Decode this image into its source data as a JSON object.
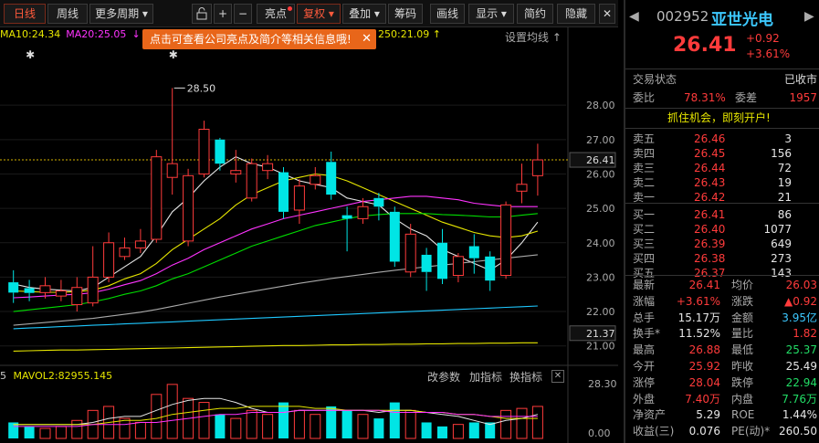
{
  "toolbar": {
    "items": [
      {
        "label": "日线",
        "active": true
      },
      {
        "label": "周线"
      },
      {
        "label": "更多周期",
        "dropdown": true
      },
      {
        "label": "亮点",
        "dot": true
      },
      {
        "label": "复权",
        "dropdown": true,
        "active": true
      },
      {
        "label": "叠加",
        "dropdown": true
      },
      {
        "label": "筹码"
      },
      {
        "label": "画线"
      },
      {
        "label": "显示",
        "dropdown": true
      },
      {
        "label": "简约"
      },
      {
        "label": "隐藏"
      }
    ]
  },
  "legend": {
    "ma10": "MA10:24.34",
    "ma20": "MA20:25.05",
    "ma250": "250:21.09",
    "setting": "设置均线",
    "tooltip": "点击可查看公司亮点及简介等相关信息哦!",
    "tooltip_close": "✕"
  },
  "volume_legend": {
    "mavol2": "MAVOL2:82955.145",
    "tools": [
      "改参数",
      "加指标",
      "换指标"
    ],
    "close": "✕",
    "left_digit": "5"
  },
  "chart_data": {
    "type": "candlestick",
    "price_axis": {
      "ticks": [
        28.0,
        27.0,
        26.0,
        25.0,
        24.0,
        23.0,
        22.0,
        21.0
      ],
      "ylim": [
        20.7,
        29.2
      ]
    },
    "current_price_label": "26.41",
    "cursor_price_label": "21.37",
    "high_annotation": "28.50",
    "volume_axis": {
      "ticks": [
        "28.30",
        "0.00"
      ],
      "ylim": [
        0,
        28.3
      ]
    },
    "candles": [
      {
        "o": 22.85,
        "c": 22.55,
        "h": 23.2,
        "l": 22.25
      },
      {
        "o": 22.68,
        "c": 22.54,
        "h": 22.92,
        "l": 22.3
      },
      {
        "o": 22.55,
        "c": 22.75,
        "h": 23.0,
        "l": 22.38
      },
      {
        "o": 22.45,
        "c": 22.6,
        "h": 22.92,
        "l": 22.3
      },
      {
        "o": 22.2,
        "c": 22.7,
        "h": 23.0,
        "l": 22.0
      },
      {
        "o": 22.25,
        "c": 23.0,
        "h": 23.9,
        "l": 22.15
      },
      {
        "o": 23.0,
        "c": 24.0,
        "h": 24.3,
        "l": 22.85
      },
      {
        "o": 23.6,
        "c": 23.85,
        "h": 24.15,
        "l": 23.5
      },
      {
        "o": 23.85,
        "c": 24.05,
        "h": 24.4,
        "l": 23.7
      },
      {
        "o": 24.1,
        "c": 26.5,
        "h": 26.7,
        "l": 24.0
      },
      {
        "o": 25.9,
        "c": 26.3,
        "h": 28.5,
        "l": 25.4
      },
      {
        "o": 24.05,
        "c": 25.95,
        "h": 26.15,
        "l": 23.9
      },
      {
        "o": 26.0,
        "c": 27.3,
        "h": 27.55,
        "l": 25.9
      },
      {
        "o": 27.0,
        "c": 26.3,
        "h": 27.05,
        "l": 26.1
      },
      {
        "o": 26.0,
        "c": 26.1,
        "h": 26.7,
        "l": 25.75
      },
      {
        "o": 25.3,
        "c": 26.3,
        "h": 26.45,
        "l": 25.2
      },
      {
        "o": 26.1,
        "c": 26.3,
        "h": 26.55,
        "l": 25.85
      },
      {
        "o": 26.05,
        "c": 24.9,
        "h": 26.2,
        "l": 24.7
      },
      {
        "o": 24.95,
        "c": 25.65,
        "h": 25.85,
        "l": 24.55
      },
      {
        "o": 25.7,
        "c": 25.95,
        "h": 26.2,
        "l": 25.55
      },
      {
        "o": 26.35,
        "c": 25.4,
        "h": 26.65,
        "l": 25.25
      },
      {
        "o": 24.8,
        "c": 24.7,
        "h": 25.05,
        "l": 23.75
      },
      {
        "o": 24.7,
        "c": 25.05,
        "h": 25.3,
        "l": 24.55
      },
      {
        "o": 25.3,
        "c": 25.05,
        "h": 25.45,
        "l": 24.65
      },
      {
        "o": 24.9,
        "c": 23.45,
        "h": 25.05,
        "l": 23.3
      },
      {
        "o": 23.15,
        "c": 24.25,
        "h": 24.55,
        "l": 23.0
      },
      {
        "o": 23.65,
        "c": 23.15,
        "h": 23.85,
        "l": 22.6
      },
      {
        "o": 24.0,
        "c": 22.95,
        "h": 24.4,
        "l": 22.8
      },
      {
        "o": 23.05,
        "c": 23.6,
        "h": 23.7,
        "l": 22.85
      },
      {
        "o": 23.9,
        "c": 23.55,
        "h": 24.25,
        "l": 23.1
      },
      {
        "o": 23.6,
        "c": 22.9,
        "h": 23.75,
        "l": 22.6
      },
      {
        "o": 23.05,
        "c": 25.1,
        "h": 25.2,
        "l": 22.95
      },
      {
        "o": 25.5,
        "c": 25.7,
        "h": 26.3,
        "l": 25.15
      },
      {
        "o": 25.95,
        "c": 26.41,
        "h": 26.88,
        "l": 25.37
      }
    ],
    "volumes": [
      8,
      6,
      5,
      6,
      9,
      14,
      16,
      10,
      8,
      22,
      27,
      20,
      18,
      12,
      10,
      14,
      12,
      18,
      14,
      12,
      16,
      14,
      12,
      10,
      18,
      14,
      8,
      6,
      7,
      8,
      8,
      14,
      15,
      16
    ],
    "series": [
      {
        "name": "MA5",
        "color": "#e6e6e6",
        "values": [
          22.8,
          22.7,
          22.65,
          22.62,
          22.6,
          22.7,
          23.0,
          23.3,
          23.6,
          24.2,
          24.9,
          25.3,
          25.8,
          26.2,
          26.5,
          26.3,
          26.2,
          26.0,
          25.8,
          25.7,
          25.6,
          25.3,
          25.2,
          25.1,
          24.7,
          24.4,
          24.2,
          23.8,
          23.6,
          23.4,
          23.2,
          23.5,
          24.0,
          24.6
        ]
      },
      {
        "name": "MA10",
        "color": "#e6e600",
        "values": [
          22.6,
          22.58,
          22.56,
          22.56,
          22.58,
          22.62,
          22.75,
          22.95,
          23.1,
          23.4,
          23.8,
          24.1,
          24.4,
          24.7,
          25.1,
          25.4,
          25.6,
          25.8,
          25.9,
          26.0,
          25.95,
          25.8,
          25.6,
          25.4,
          25.2,
          25.0,
          24.8,
          24.6,
          24.45,
          24.3,
          24.2,
          24.15,
          24.2,
          24.34
        ]
      },
      {
        "name": "MA20",
        "color": "#ff33ff",
        "values": [
          22.4,
          22.42,
          22.45,
          22.48,
          22.5,
          22.55,
          22.65,
          22.78,
          22.9,
          23.1,
          23.35,
          23.55,
          23.8,
          24.0,
          24.2,
          24.4,
          24.55,
          24.7,
          24.8,
          24.9,
          25.0,
          25.1,
          25.2,
          25.25,
          25.3,
          25.35,
          25.35,
          25.3,
          25.25,
          25.15,
          25.1,
          25.05,
          25.05,
          25.05
        ]
      },
      {
        "name": "MA30",
        "color": "#00dd00",
        "values": [
          22.0,
          22.05,
          22.1,
          22.15,
          22.2,
          22.28,
          22.38,
          22.5,
          22.6,
          22.75,
          22.95,
          23.1,
          23.3,
          23.5,
          23.7,
          23.9,
          24.05,
          24.2,
          24.35,
          24.5,
          24.6,
          24.7,
          24.78,
          24.82,
          24.85,
          24.85,
          24.85,
          24.82,
          24.8,
          24.78,
          24.75,
          24.75,
          24.8,
          24.85
        ]
      },
      {
        "name": "MA60",
        "color": "#aaaaaa",
        "values": [
          21.6,
          21.64,
          21.68,
          21.72,
          21.76,
          21.8,
          21.86,
          21.92,
          21.98,
          22.06,
          22.15,
          22.24,
          22.33,
          22.42,
          22.5,
          22.58,
          22.66,
          22.74,
          22.82,
          22.89,
          22.96,
          23.02,
          23.08,
          23.14,
          23.2,
          23.25,
          23.3,
          23.35,
          23.4,
          23.45,
          23.5,
          23.55,
          23.6,
          23.65
        ]
      },
      {
        "name": "MA120",
        "color": "#1ec8ff",
        "values": [
          21.5,
          21.52,
          21.54,
          21.56,
          21.58,
          21.6,
          21.62,
          21.64,
          21.66,
          21.68,
          21.7,
          21.72,
          21.74,
          21.76,
          21.78,
          21.8,
          21.82,
          21.84,
          21.86,
          21.88,
          21.9,
          21.92,
          21.94,
          21.96,
          21.98,
          22.0,
          22.02,
          22.04,
          22.06,
          22.08,
          22.1,
          22.12,
          22.14,
          22.16
        ]
      },
      {
        "name": "MA250",
        "color": "#e6e600",
        "values": [
          20.85,
          20.86,
          20.87,
          20.88,
          20.88,
          20.89,
          20.9,
          20.91,
          20.92,
          20.93,
          20.94,
          20.95,
          20.96,
          20.97,
          20.98,
          20.99,
          21.0,
          21.01,
          21.01,
          21.02,
          21.03,
          21.03,
          21.04,
          21.04,
          21.05,
          21.05,
          21.06,
          21.06,
          21.07,
          21.07,
          21.08,
          21.08,
          21.09,
          21.09
        ]
      }
    ],
    "vol_series": [
      {
        "name": "MAVOL1",
        "color": "#e6e6e6",
        "values": [
          7,
          7,
          7,
          7,
          7,
          8,
          10,
          11,
          11,
          14,
          17,
          19,
          20,
          20,
          18,
          15,
          13,
          13,
          14,
          14,
          14,
          14,
          14,
          13,
          14,
          14,
          13,
          12,
          11,
          9,
          7,
          9,
          10,
          12
        ]
      },
      {
        "name": "MAVOL2",
        "color": "#e6e600",
        "values": [
          7,
          7,
          7,
          7,
          7,
          7,
          8,
          9,
          9,
          10,
          12,
          13,
          14,
          15,
          15,
          16,
          16,
          16,
          16,
          15,
          15,
          14,
          14,
          14,
          14,
          14,
          13,
          13,
          12,
          12,
          11,
          10,
          10,
          10
        ]
      },
      {
        "name": "MAVOL3",
        "color": "#ff33ff",
        "values": [
          6,
          6,
          6,
          6,
          6,
          7,
          7,
          7,
          8,
          8,
          9,
          10,
          11,
          12,
          12,
          13,
          13,
          13,
          14,
          14,
          14,
          14,
          14,
          14,
          13,
          13,
          13,
          13,
          12,
          12,
          11,
          11,
          11,
          11
        ]
      }
    ]
  },
  "quote": {
    "code": "002952",
    "name": "亚世光电",
    "price": "26.41",
    "change": "+0.92",
    "change_pct": "+3.61%",
    "status_label": "交易状态",
    "status_value": "已收市",
    "weibi_label": "委比",
    "weibi_value": "78.31%",
    "weicha_label": "委差",
    "weicha_value": "1957",
    "promo": "抓住机会，即刻开户!",
    "asks": [
      {
        "label": "卖五",
        "price": "26.46",
        "vol": "3"
      },
      {
        "label": "卖四",
        "price": "26.45",
        "vol": "156"
      },
      {
        "label": "卖三",
        "price": "26.44",
        "vol": "72"
      },
      {
        "label": "卖二",
        "price": "26.43",
        "vol": "19"
      },
      {
        "label": "卖一",
        "price": "26.42",
        "vol": "21"
      }
    ],
    "bids": [
      {
        "label": "买一",
        "price": "26.41",
        "vol": "86"
      },
      {
        "label": "买二",
        "price": "26.40",
        "vol": "1077"
      },
      {
        "label": "买三",
        "price": "26.39",
        "vol": "649"
      },
      {
        "label": "买四",
        "price": "26.38",
        "vol": "273"
      },
      {
        "label": "买五",
        "price": "26.37",
        "vol": "143"
      }
    ],
    "stats": [
      {
        "l1": "最新",
        "v1": "26.41",
        "c1": "red",
        "l2": "均价",
        "v2": "26.03",
        "c2": "red"
      },
      {
        "l1": "涨幅",
        "v1": "+3.61%",
        "c1": "red",
        "l2": "涨跌",
        "v2": "▲0.92",
        "c2": "red"
      },
      {
        "l1": "总手",
        "v1": "15.17万",
        "c1": "white",
        "l2": "金额",
        "v2": "3.95亿",
        "c2": "cyan"
      },
      {
        "l1": "换手*",
        "v1": "11.52%",
        "c1": "white",
        "l2": "量比",
        "v2": "1.82",
        "c2": "red"
      },
      {
        "l1": "最高",
        "v1": "26.88",
        "c1": "red",
        "l2": "最低",
        "v2": "25.37",
        "c2": "green"
      },
      {
        "l1": "今开",
        "v1": "25.92",
        "c1": "red",
        "l2": "昨收",
        "v2": "25.49",
        "c2": "white"
      },
      {
        "l1": "涨停",
        "v1": "28.04",
        "c1": "red",
        "l2": "跌停",
        "v2": "22.94",
        "c2": "green"
      },
      {
        "l1": "外盘",
        "v1": "7.40万",
        "c1": "red",
        "l2": "内盘",
        "v2": "7.76万",
        "c2": "green"
      },
      {
        "l1": "净资产",
        "v1": "5.29",
        "c1": "white",
        "l2": "ROE",
        "v2": "1.44%",
        "c2": "white"
      },
      {
        "l1": "收益(三)",
        "v1": "0.076",
        "c1": "white",
        "l2": "PE(动)*",
        "v2": "260.50",
        "c2": "white"
      }
    ]
  }
}
